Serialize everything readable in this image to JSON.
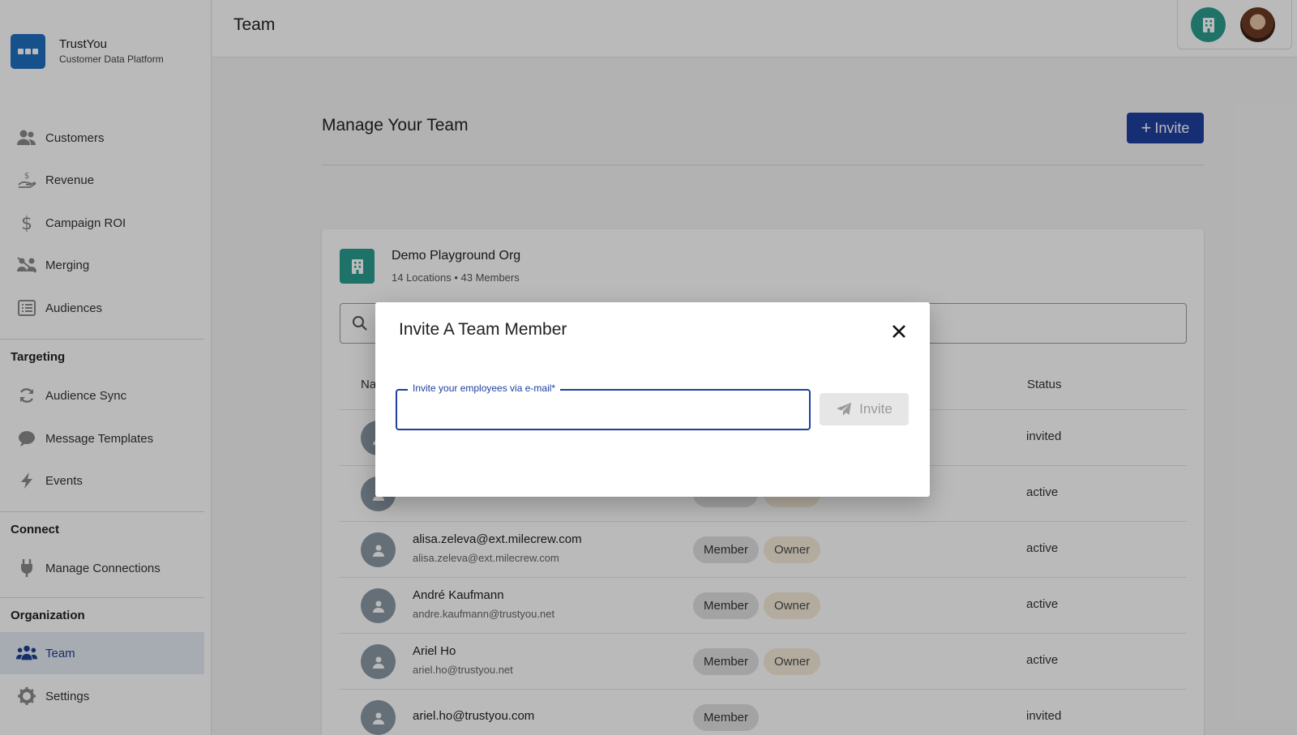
{
  "brand": {
    "name": "TrustYou",
    "subtitle": "Customer Data Platform"
  },
  "sidebar": {
    "items": [
      {
        "label": "Customers",
        "icon": "people-icon"
      },
      {
        "label": "Revenue",
        "icon": "hand-dollar-icon"
      },
      {
        "label": "Campaign ROI",
        "icon": "dollar-icon"
      },
      {
        "label": "Merging",
        "icon": "merge-people-icon"
      },
      {
        "label": "Audiences",
        "icon": "list-icon"
      }
    ],
    "targeting": {
      "title": "Targeting",
      "items": [
        {
          "label": "Audience Sync",
          "icon": "sync-icon"
        },
        {
          "label": "Message Templates",
          "icon": "chat-bubble-icon"
        },
        {
          "label": "Events",
          "icon": "bolt-icon"
        }
      ]
    },
    "connect": {
      "title": "Connect",
      "items": [
        {
          "label": "Manage Connections",
          "icon": "plug-icon"
        }
      ]
    },
    "organization": {
      "title": "Organization",
      "items": [
        {
          "label": "Team",
          "icon": "team-icon",
          "active": true
        },
        {
          "label": "Settings",
          "icon": "gear-icon"
        }
      ]
    }
  },
  "header": {
    "title": "Team"
  },
  "main": {
    "title": "Manage Your Team",
    "invite_label": "Invite",
    "org": {
      "name": "Demo Playground Org",
      "meta": "14 Locations • 43 Members"
    },
    "table": {
      "col_name": "Na",
      "col_status": "Status",
      "rows": [
        {
          "name": "",
          "email": "",
          "roles": [],
          "status": "invited"
        },
        {
          "name": "",
          "email": "",
          "roles": [],
          "status": "active"
        },
        {
          "name": "alisa.zeleva@ext.milecrew.com",
          "email": "alisa.zeleva@ext.milecrew.com",
          "roles": [
            "Member",
            "Owner"
          ],
          "status": "active"
        },
        {
          "name": "André Kaufmann",
          "email": "andre.kaufmann@trustyou.net",
          "roles": [
            "Member",
            "Owner"
          ],
          "status": "active"
        },
        {
          "name": "Ariel Ho",
          "email": "ariel.ho@trustyou.net",
          "roles": [
            "Member",
            "Owner"
          ],
          "status": "active"
        },
        {
          "name": "ariel.ho@trustyou.com",
          "email": "",
          "roles": [
            "Member"
          ],
          "status": "invited"
        }
      ]
    }
  },
  "modal": {
    "title": "Invite A Team Member",
    "field_label": "Invite your employees via e-mail*",
    "field_value": "",
    "submit_label": "Invite"
  },
  "colors": {
    "primary": "#1e3fa0",
    "teal": "#2a9d8f",
    "brand_blue": "#1f70c1"
  }
}
